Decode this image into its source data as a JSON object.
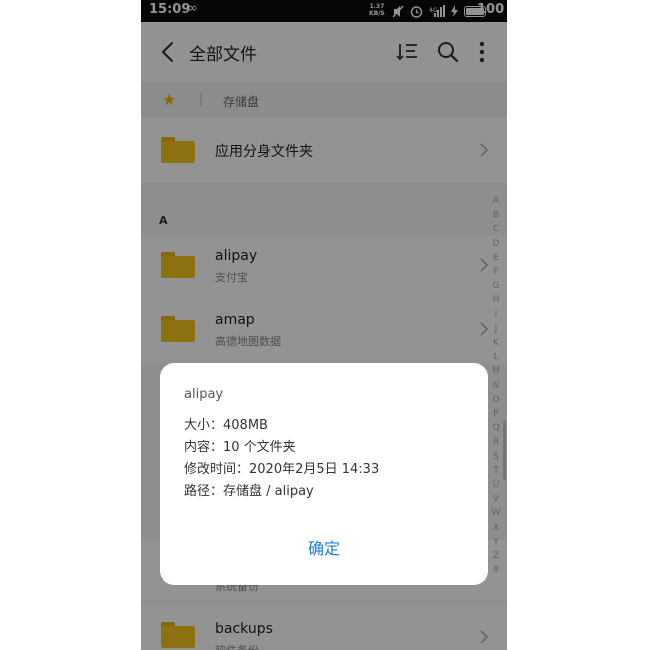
{
  "status_bar": {
    "time": "15:09",
    "net_speed_value": "1.37",
    "net_speed_unit": "KB/S",
    "battery": "100",
    "icons": [
      "infinity-icon",
      "mute-icon",
      "alarm-icon",
      "signal-icon",
      "charging-icon",
      "battery-icon"
    ]
  },
  "header": {
    "title": "全部文件"
  },
  "breadcrumb": {
    "separator": "|",
    "location": "存储盘"
  },
  "special_folder": {
    "name": "应用分身文件夹"
  },
  "section_header": "A",
  "folders": [
    {
      "name": "alipay",
      "subtitle": "支付宝"
    },
    {
      "name": "amap",
      "subtitle": "高德地图数据"
    },
    {
      "name": "",
      "subtitle": "系统备份"
    },
    {
      "name": "backups",
      "subtitle": "软件备份"
    }
  ],
  "alphabet_index": [
    "A",
    "B",
    "C",
    "D",
    "E",
    "F",
    "G",
    "H",
    "I",
    "J",
    "K",
    "L",
    "M",
    "N",
    "O",
    "P",
    "Q",
    "R",
    "S",
    "T",
    "U",
    "V",
    "W",
    "X",
    "Y",
    "Z",
    "#"
  ],
  "dialog": {
    "title": "alipay",
    "size": "大小：408MB",
    "contents": "内容：10 个文件夹",
    "modified": "修改时间：2020年2月5日 14:33",
    "path": "路径：存储盘 / alipay",
    "confirm_label": "确定"
  },
  "colors": {
    "folder": "#f3c21b",
    "star": "#e8b800",
    "accent": "#1e7de0"
  }
}
